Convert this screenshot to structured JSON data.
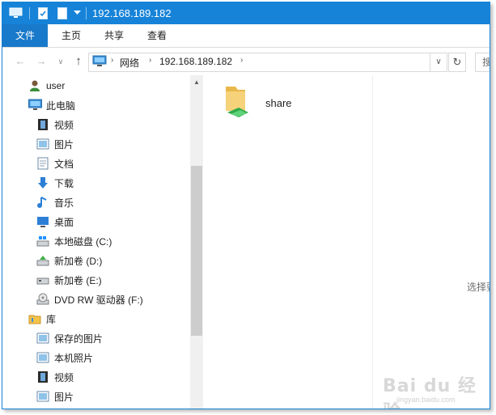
{
  "window": {
    "title": "192.168.189.182",
    "colors": {
      "titlebar": "#1683d8",
      "file_tab": "#1979ca"
    }
  },
  "quick_access": {
    "icons": [
      "computer-icon",
      "properties-check-icon",
      "new-folder-icon",
      "customize-dropdown-icon"
    ]
  },
  "ribbon": {
    "tabs": [
      {
        "label": "文件"
      },
      {
        "label": "主页"
      },
      {
        "label": "共享"
      },
      {
        "label": "查看"
      }
    ]
  },
  "address": {
    "crumbs": [
      "网络",
      "192.168.189.182"
    ],
    "search_placeholder": "搜"
  },
  "nav": {
    "items": [
      {
        "label": "user",
        "icon": "user-icon"
      },
      {
        "label": "此电脑",
        "icon": "pc-icon"
      },
      {
        "label": "视频",
        "icon": "video-icon"
      },
      {
        "label": "图片",
        "icon": "pictures-icon"
      },
      {
        "label": "文档",
        "icon": "documents-icon"
      },
      {
        "label": "下载",
        "icon": "download-icon"
      },
      {
        "label": "音乐",
        "icon": "music-icon"
      },
      {
        "label": "桌面",
        "icon": "desktop-icon"
      },
      {
        "label": "本地磁盘 (C:)",
        "icon": "drive-c-icon"
      },
      {
        "label": "新加卷 (D:)",
        "icon": "drive-d-icon"
      },
      {
        "label": "新加卷 (E:)",
        "icon": "drive-e-icon"
      },
      {
        "label": "DVD RW 驱动器 (F:)",
        "icon": "dvd-drive-icon"
      },
      {
        "label": "库",
        "icon": "library-icon"
      },
      {
        "label": "保存的图片",
        "icon": "saved-pictures-icon"
      },
      {
        "label": "本机照片",
        "icon": "camera-roll-icon"
      },
      {
        "label": "视频",
        "icon": "video-icon"
      },
      {
        "label": "图片",
        "icon": "pictures-icon"
      }
    ]
  },
  "content": {
    "items": [
      {
        "label": "share",
        "icon": "shared-folder-icon"
      }
    ],
    "preview_text": "选择要"
  },
  "watermark": {
    "brand": "Bai du 经验",
    "url": "jingyan.baidu.com"
  }
}
